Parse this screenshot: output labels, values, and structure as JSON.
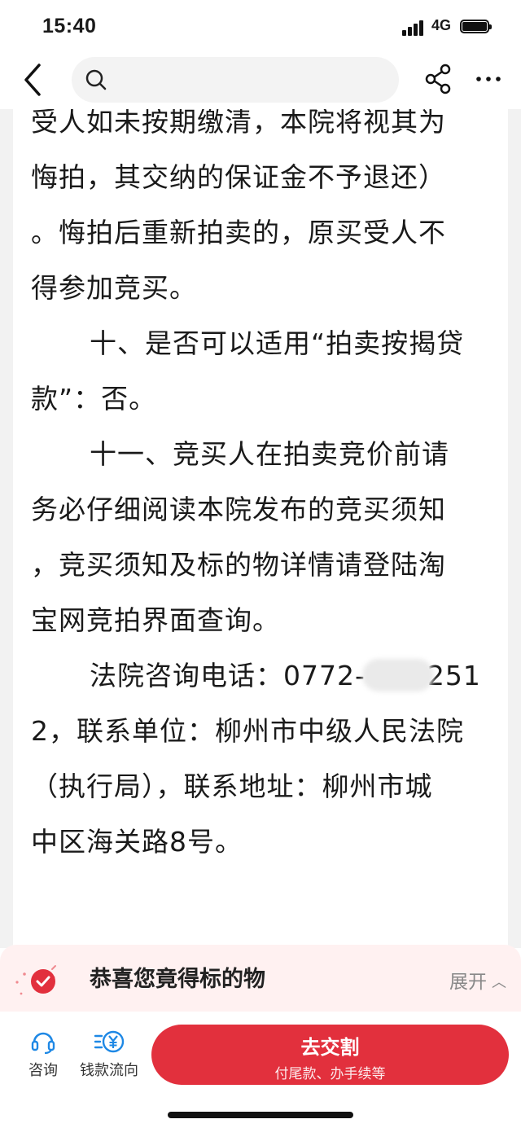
{
  "status_bar": {
    "time": "15:40",
    "network": "4G",
    "icons": [
      "signal-icon",
      "battery-icon"
    ]
  },
  "nav": {
    "search_placeholder": "",
    "icons": [
      "back-icon",
      "search-icon",
      "share-icon",
      "more-icon"
    ]
  },
  "article": {
    "lines": [
      "受人如未按期缴清，本院将视其为",
      "悔拍，其交纳的保证金不予退还）",
      "。悔拍后重新拍卖的，原买受人不",
      "得参加竞买。",
      "十、是否可以适用“拍卖按揭贷",
      "款”：否。",
      "十一、竞买人在拍卖竞价前请",
      "务必仔细阅读本院发布的竞买须知",
      "，竞买须知及标的物详情请登陆淘",
      "宝网竞拍界面查询。",
      "法院咨询电话：0772-",
      "251",
      "2，联系单位：柳州市中级人民法院",
      "（执行局），联系地址：柳州市城",
      "中区海关路8号。"
    ]
  },
  "banner": {
    "title": "恭喜您竟得标的物",
    "expand_label": "展开",
    "icon": "check-circle-icon"
  },
  "actions": {
    "consult_label": "咨询",
    "funds_label": "钱款流向",
    "pay_main_label": "去交割",
    "pay_sub_label": "付尾款、办手续等"
  },
  "colors": {
    "accent": "#e2303d",
    "banner_bg": "#fff1f1",
    "action_icon": "#1e88e5"
  }
}
